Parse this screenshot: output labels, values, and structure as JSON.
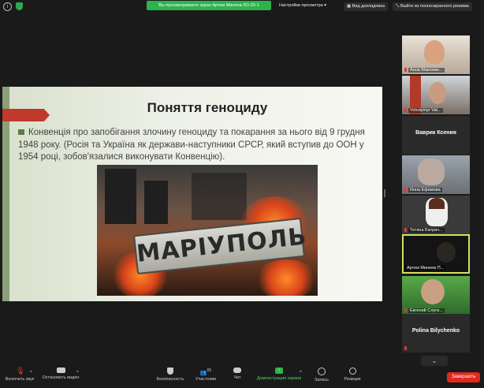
{
  "topbar": {
    "banner": "Вы просматриваете экран Артем Минеев ЛО-20-1",
    "view_settings": "Настройки просмотра ▾",
    "view_mode": "Вид докладчика",
    "fullscreen": "Выйти из полноэкранного режима"
  },
  "slide": {
    "title": "Поняття геноциду",
    "body": "Конвенція про запобігання злочину геноциду та покарання за нього від 9 грудня 1948 року. (Росія та Україна як держави-наступники СРСР, який вступив до ООН у 1954 році, зобов'язалися виконувати Конвенцію).",
    "sign_text": "МАРІУПОЛЬ"
  },
  "participants": [
    {
      "name": "Анна Максимо..."
    },
    {
      "name": "Volodymyr Vat..."
    },
    {
      "name": "Ваврик Ксения"
    },
    {
      "name": "Инна Ефимова"
    },
    {
      "name": "Тетяна Батрач..."
    },
    {
      "name": "Артем Минеев П..."
    },
    {
      "name": "Евгений Слуги..."
    },
    {
      "name": "Polina Bilychenko"
    }
  ],
  "toolbar": {
    "mic": "Включить звук",
    "video": "Остановить видео",
    "security": "Безопасность",
    "participants": "Участники",
    "participants_count": "65",
    "chat": "Чат",
    "share": "Демонстрация экрана",
    "record": "Запись",
    "reactions": "Реакции",
    "end": "Завершить"
  },
  "colors": {
    "accent_green": "#2db34a",
    "end_red": "#e0281e",
    "active_border": "#d6e061"
  }
}
